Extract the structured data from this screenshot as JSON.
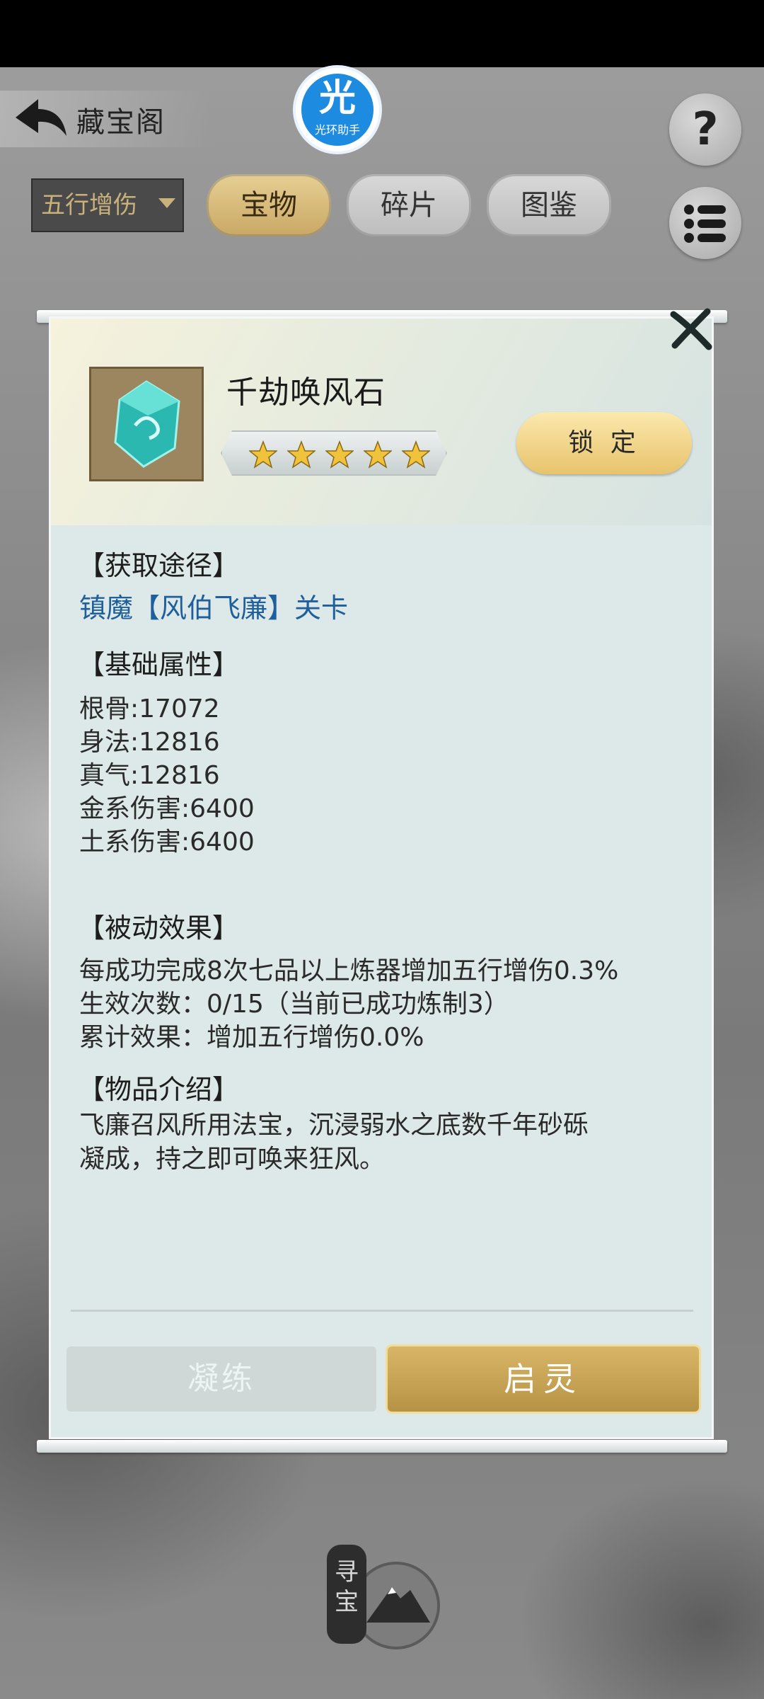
{
  "header": {
    "title": "藏宝阁",
    "helper_logo_glyph": "光",
    "helper_logo_caption": "光环助手",
    "help_label": "?"
  },
  "filter": {
    "dropdown_value": "五行增伤"
  },
  "tabs": [
    {
      "label": "宝物",
      "active": true
    },
    {
      "label": "碎片",
      "active": false
    },
    {
      "label": "图鉴",
      "active": false
    }
  ],
  "item": {
    "name": "千劫唤风石",
    "stars": 5,
    "lock_label": "锁 定"
  },
  "sections": {
    "source_head": "【获取途径】",
    "source_link": "镇魔【风伯飞廉】关卡",
    "attr_head": "【基础属性】",
    "attrs": [
      "根骨:17072",
      "身法:12816",
      "真气:12816",
      "金系伤害:6400",
      "土系伤害:6400"
    ],
    "passive_head": "【被动效果】",
    "passive_lines": [
      "每成功完成8次七品以上炼器增加五行增伤0.3%",
      "生效次数：0/15（当前已成功炼制3）",
      "累计效果：增加五行增伤0.0%"
    ],
    "intro_head": "【物品介绍】",
    "intro_lines": [
      "飞廉召风所用法宝，沉浸弱水之底数千年砂砾",
      "凝成，持之即可唤来狂风。"
    ]
  },
  "actions": {
    "refine_label": "凝练",
    "awaken_label": "启灵"
  },
  "bottom": {
    "seek_label": "寻宝"
  },
  "colors": {
    "gold_button": "#d9b667",
    "link_blue": "#1f5f9c",
    "panel_bg": "#dde9e8"
  }
}
